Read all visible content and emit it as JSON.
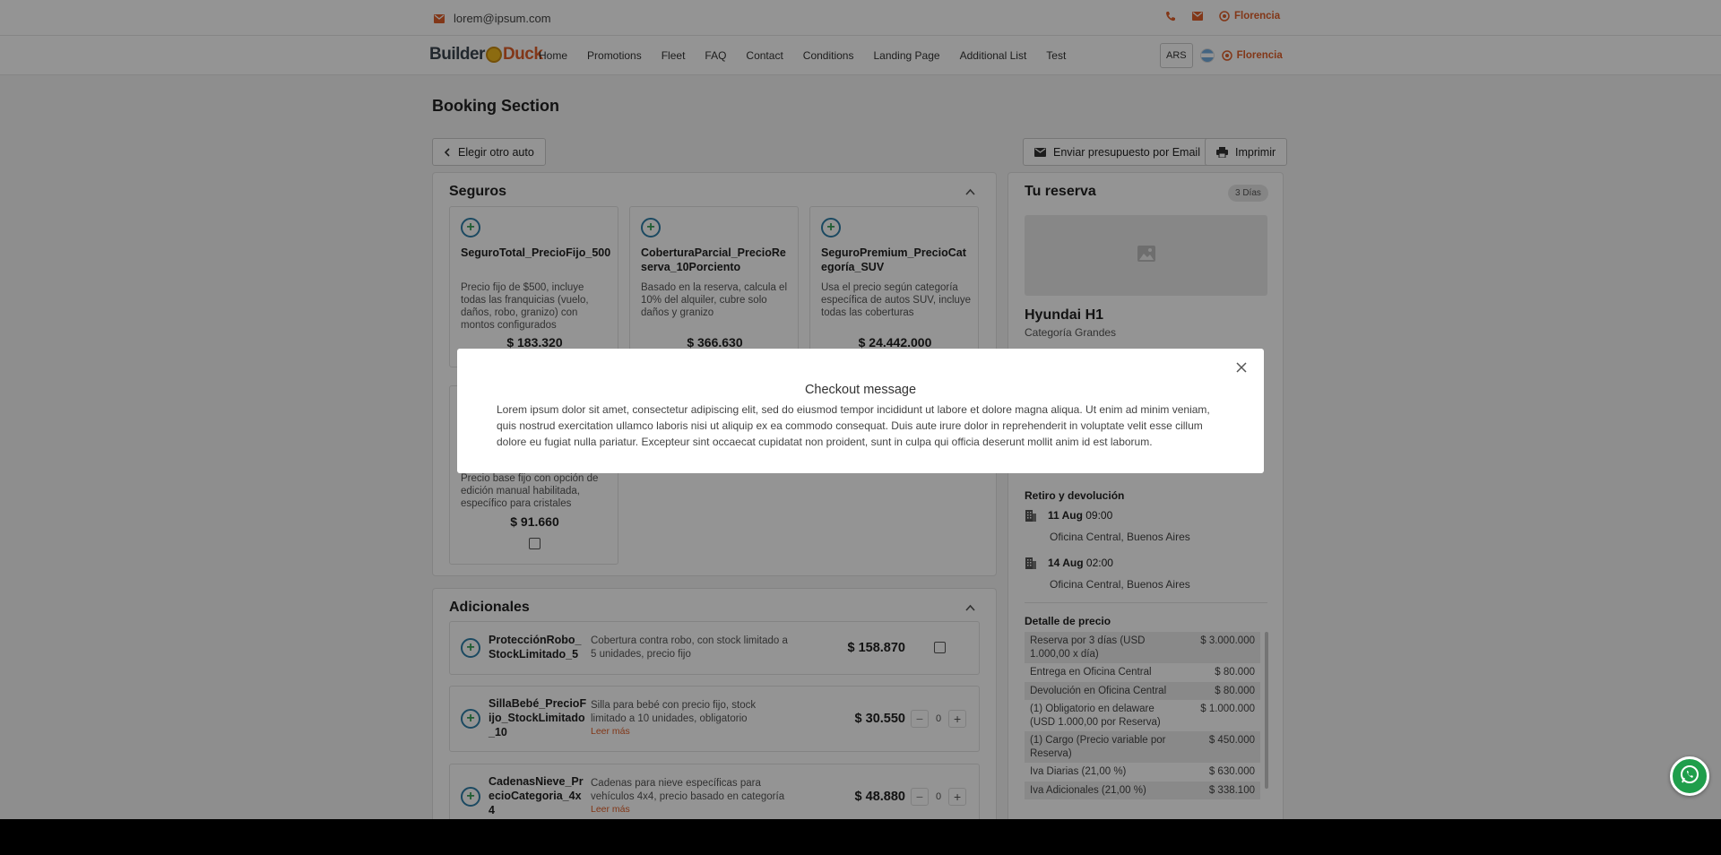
{
  "topbar": {
    "email": "lorem@ipsum.com",
    "city": "Florencia"
  },
  "navbar": {
    "logo_part1": "Builder",
    "logo_part2": "Duck",
    "links": [
      "Home",
      "Promotions",
      "Fleet",
      "FAQ",
      "Contact",
      "Conditions",
      "Landing Page",
      "Additional List",
      "Test"
    ],
    "currency": "ARS",
    "city": "Florencia"
  },
  "page": {
    "title": "Booking Section",
    "back_label": "Elegir otro auto",
    "email_button": "Enviar presupuesto por Email",
    "print_button": "Imprimir"
  },
  "seguros": {
    "title": "Seguros",
    "cards": [
      {
        "name": "SeguroTotal_PrecioFijo_500",
        "desc": "Precio fijo de $500, incluye todas las franquicias (vuelo, daños, robo, granizo) con montos configurados",
        "price": "$ 183.320"
      },
      {
        "name": "CoberturaParcial_PrecioReserva_10Porciento",
        "desc": "Basado en la reserva, calcula el 10% del alquiler, cubre solo daños y granizo",
        "price": "$ 366.630"
      },
      {
        "name": "SeguroPremium_PrecioCategoría_SUV",
        "desc": "Usa el precio según categoría específica de autos SUV, incluye todas las coberturas",
        "price": "$ 24.442.000"
      },
      {
        "name": "",
        "desc": "Precio base fijo con opción de edición manual habilitada, específico para cristales",
        "price": "$ 91.660"
      }
    ]
  },
  "adicionales": {
    "title": "Adicionales",
    "read_more": "Leer más",
    "items": [
      {
        "name": "ProtecciónRobo_StockLimitado_5",
        "desc": "Cobertura contra robo, con stock limitado a 5 unidades, precio fijo",
        "price": "$ 158.870"
      },
      {
        "name": "SillaBebé_PrecioFijo_StockLimitado_10",
        "desc": "Silla para bebé con precio fijo, stock limitado a 10 unidades, obligatorio",
        "price": "$ 30.550",
        "qty": "0"
      },
      {
        "name": "CadenasNieve_PrecioCategoria_4x4",
        "desc": "Cadenas para nieve específicas para vehículos 4x4, precio basado en categoría",
        "price": "$ 48.880",
        "qty": "0"
      }
    ]
  },
  "reserva": {
    "title": "Tu reserva",
    "days_badge": "3 Días",
    "car_name": "Hyundai H1",
    "car_category": "Categoría Grandes",
    "retiro_title": "Retiro y devolución",
    "pickup_date": "11 Aug",
    "pickup_time": "09:00",
    "pickup_place": "Oficina Central, Buenos Aires",
    "return_date": "14 Aug",
    "return_time": "02:00",
    "return_place": "Oficina Central, Buenos Aires",
    "price_title": "Detalle de precio",
    "price_rows": [
      {
        "label": "Reserva por 3 días (USD 1.000,00 x día)",
        "value": "$ 3.000.000"
      },
      {
        "label": "Entrega en Oficina Central",
        "value": "$ 80.000"
      },
      {
        "label": "Devolución en Oficina Central",
        "value": "$ 80.000"
      },
      {
        "label": "(1) Obligatorio en delaware (USD 1.000,00 por Reserva)",
        "value": "$ 1.000.000"
      },
      {
        "label": "(1) Cargo (Precio variable por Reserva)",
        "value": "$ 450.000"
      },
      {
        "label": "Iva Diarias (21,00 %)",
        "value": "$ 630.000"
      },
      {
        "label": "Iva Adicionales (21,00 %)",
        "value": "$ 338.100"
      }
    ]
  },
  "modal": {
    "title": "Checkout message",
    "body": "Lorem ipsum dolor sit amet, consectetur adipiscing elit, sed do eiusmod tempor incididunt ut labore et dolore magna aliqua. Ut enim ad minim veniam, quis nostrud exercitation ullamco laboris nisi ut aliquip ex ea commodo consequat. Duis aute irure dolor in reprehenderit in voluptate velit esse cillum dolore eu fugiat nulla pariatur. Excepteur sint occaecat cupidatat non proident, sunt in culpa qui officia deserunt mollit anim id est laborum."
  },
  "colors": {
    "accent": "#e0602a",
    "whatsapp": "#1f9e4b"
  }
}
